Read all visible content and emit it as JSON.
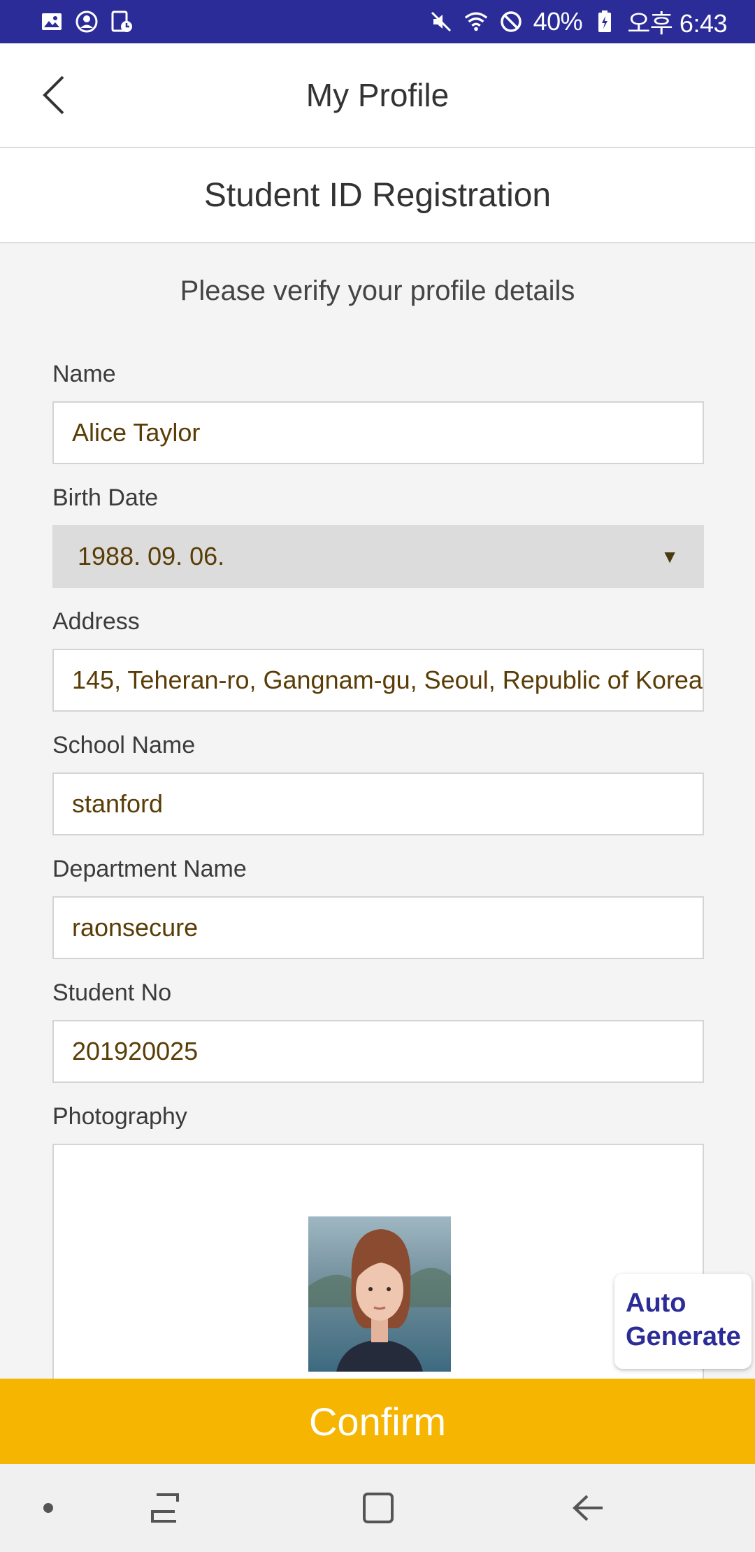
{
  "status_bar": {
    "battery": "40%",
    "time": "오후 6:43",
    "left_icons": [
      "gallery-icon",
      "account-circle-icon",
      "document-clock-icon"
    ],
    "right_icons": [
      "mute-icon",
      "wifi-icon",
      "blocked-icon",
      "battery-icon"
    ]
  },
  "header": {
    "title": "My Profile",
    "back_icon": "chevron-left-icon"
  },
  "sub_header": {
    "title": "Student ID Registration"
  },
  "form": {
    "instruction": "Please verify your profile details",
    "name": {
      "label": "Name",
      "value": "Alice Taylor"
    },
    "birth_date": {
      "label": "Birth Date",
      "value": "1988. 09. 06."
    },
    "address": {
      "label": "Address",
      "value": "145, Teheran-ro, Gangnam-gu, Seoul, Republic of Korea"
    },
    "school_name": {
      "label": "School Name",
      "value": "stanford"
    },
    "department_name": {
      "label": "Department Name",
      "value": "raonsecure"
    },
    "student_no": {
      "label": "Student No",
      "value": "201920025"
    },
    "photography": {
      "label": "Photography"
    }
  },
  "auto_generate": {
    "line1": "Auto",
    "line2": "Generate"
  },
  "confirm": {
    "label": "Confirm"
  },
  "colors": {
    "status_bar": "#2b2c98",
    "accent": "#f5b501",
    "auto_generate_text": "#2b2c98",
    "value_text": "#5a3d06"
  },
  "nav_bar": {
    "icons": [
      "dot-icon",
      "recent-apps-icon",
      "home-icon",
      "back-arrow-icon"
    ]
  }
}
